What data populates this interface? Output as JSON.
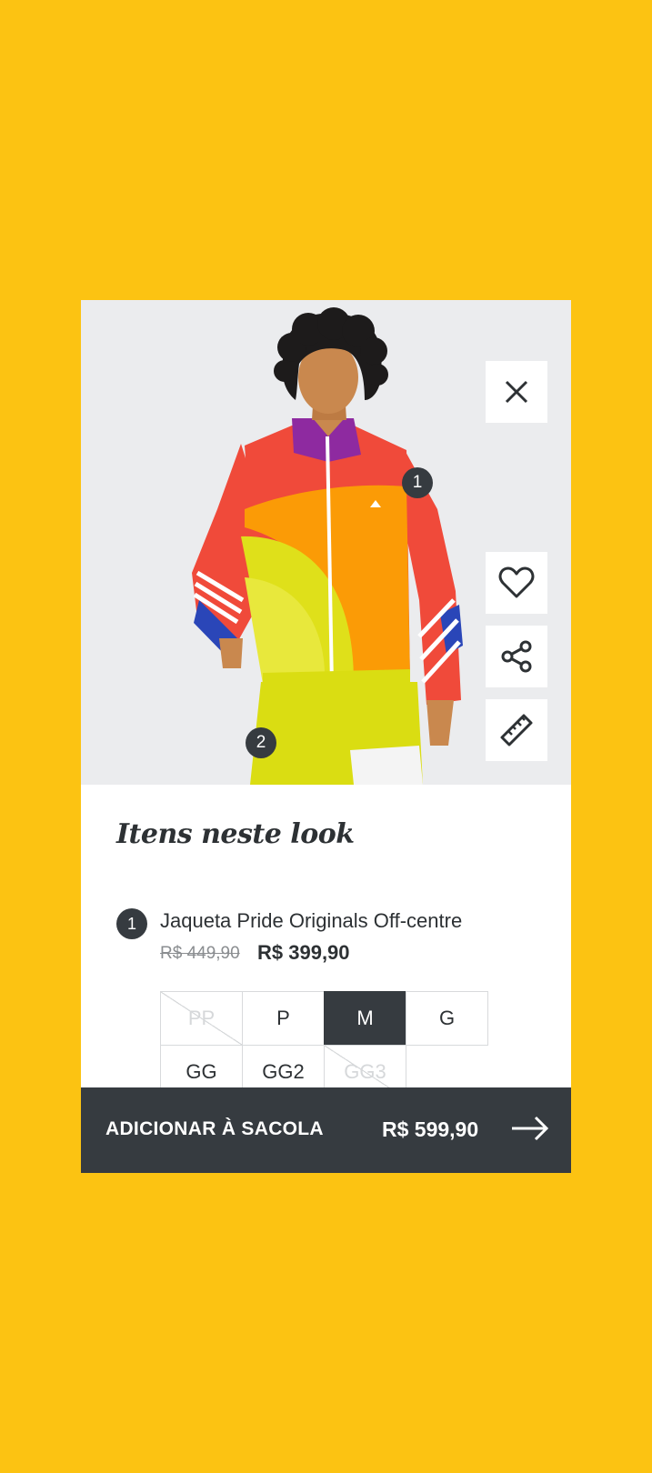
{
  "actions": {
    "close_icon": "close-icon",
    "favorite_icon": "heart-icon",
    "share_icon": "share-icon",
    "size_guide_icon": "ruler-icon"
  },
  "hotspots": [
    {
      "label": "1"
    },
    {
      "label": "2"
    }
  ],
  "look": {
    "title": "Itens neste look",
    "items": [
      {
        "number": "1",
        "name": "Jaqueta Pride Originals Off-centre",
        "old_price": "R$ 449,90",
        "price": "R$ 399,90",
        "sizes": [
          {
            "label": "PP",
            "available": false,
            "selected": false
          },
          {
            "label": "P",
            "available": true,
            "selected": false
          },
          {
            "label": "M",
            "available": true,
            "selected": true
          },
          {
            "label": "G",
            "available": true,
            "selected": false
          },
          {
            "label": "GG",
            "available": true,
            "selected": false
          },
          {
            "label": "GG2",
            "available": true,
            "selected": false
          },
          {
            "label": "GG3",
            "available": false,
            "selected": false
          }
        ]
      }
    ]
  },
  "cart": {
    "button_label": "ADICIONAR À SACOLA",
    "total": "R$ 599,90",
    "arrow_icon": "arrow-right-icon"
  },
  "colors": {
    "background": "#fcc312",
    "dark": "#363b40",
    "image_bg": "#ebecee"
  }
}
